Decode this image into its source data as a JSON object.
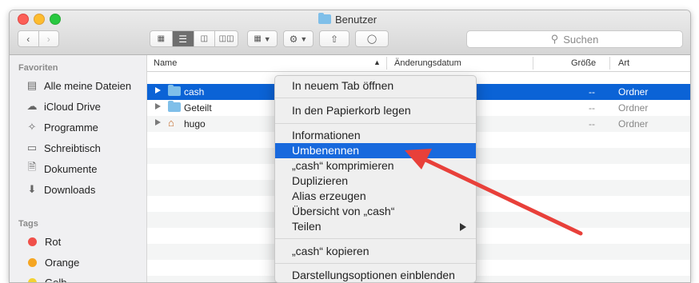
{
  "window": {
    "title": "Benutzer"
  },
  "toolbar": {
    "search_placeholder": "Suchen"
  },
  "sidebar": {
    "favorites_header": "Favoriten",
    "favorites": [
      {
        "label": "Alle meine Dateien",
        "icon": "all-files-icon"
      },
      {
        "label": "iCloud Drive",
        "icon": "cloud-icon"
      },
      {
        "label": "Programme",
        "icon": "apps-icon"
      },
      {
        "label": "Schreibtisch",
        "icon": "desktop-icon"
      },
      {
        "label": "Dokumente",
        "icon": "documents-icon"
      },
      {
        "label": "Downloads",
        "icon": "download-icon"
      }
    ],
    "tags_header": "Tags",
    "tags": [
      {
        "label": "Rot",
        "color": "#f0504a"
      },
      {
        "label": "Orange",
        "color": "#f5a623"
      },
      {
        "label": "Gelb",
        "color": "#f3d233"
      }
    ]
  },
  "columns": {
    "name": "Name",
    "date": "Änderungsdatum",
    "size": "Größe",
    "kind": "Art"
  },
  "files": [
    {
      "name": "cash",
      "size": "--",
      "kind": "Ordner",
      "icon": "folder-icon",
      "selected": true
    },
    {
      "name": "Geteilt",
      "size": "--",
      "kind": "Ordner",
      "icon": "folder-icon",
      "selected": false
    },
    {
      "name": "hugo",
      "size": "--",
      "kind": "Ordner",
      "icon": "home-folder-icon",
      "selected": false
    }
  ],
  "context_menu": {
    "items": [
      "In neuem Tab öffnen",
      "In den Papierkorb legen",
      "Informationen",
      "Umbenennen",
      "„cash“ komprimieren",
      "Duplizieren",
      "Alias erzeugen",
      "Übersicht von „cash“",
      "Teilen",
      "„cash“ kopieren",
      "Darstellungsoptionen einblenden"
    ],
    "highlighted": "Umbenennen"
  },
  "colors": {
    "selection": "#0b63d6",
    "menu_highlight": "#1869dd",
    "annotation_arrow": "#e8403a"
  }
}
